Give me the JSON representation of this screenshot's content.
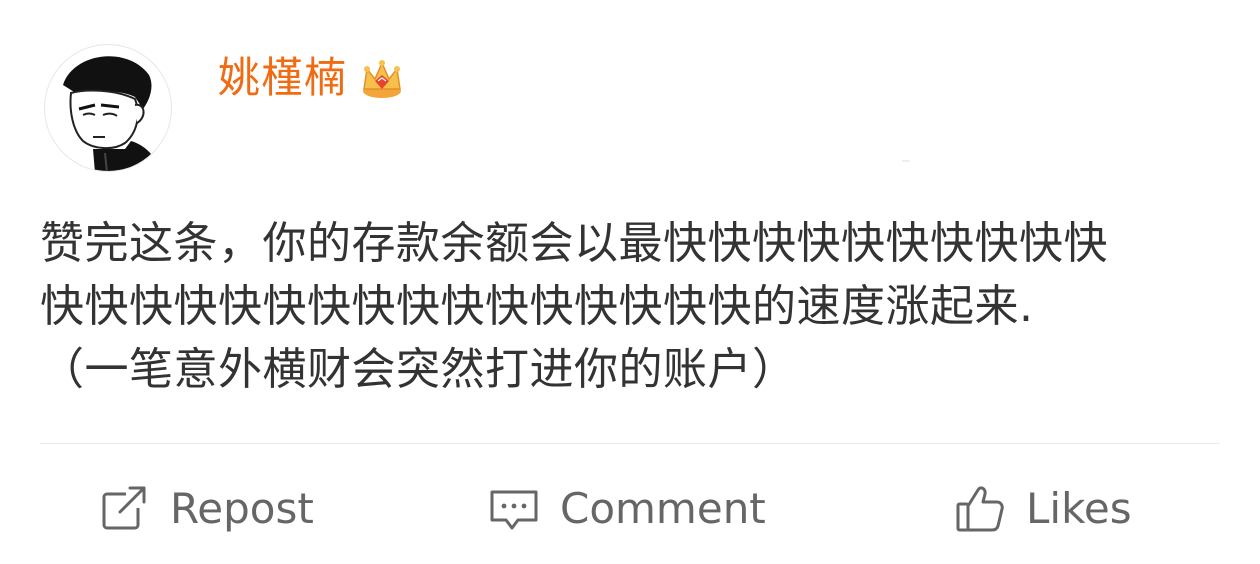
{
  "post": {
    "author": {
      "name": "姚槿楠",
      "avatar_icon": "anime-avatar-icon",
      "badge_icon": "crown-badge-icon",
      "name_color": "#f06b12"
    },
    "content": "赞完这条，你的存款余额会以最快快快快快快快快快快\n快快快快快快快快快快快快快快快快的速度涨起来.\n（一笔意外横财会突然打进你的账户）",
    "actions": [
      {
        "label": "Repost",
        "icon": "repost-icon"
      },
      {
        "label": "Comment",
        "icon": "comment-icon"
      },
      {
        "label": "Likes",
        "icon": "thumbs-up-icon"
      }
    ]
  }
}
